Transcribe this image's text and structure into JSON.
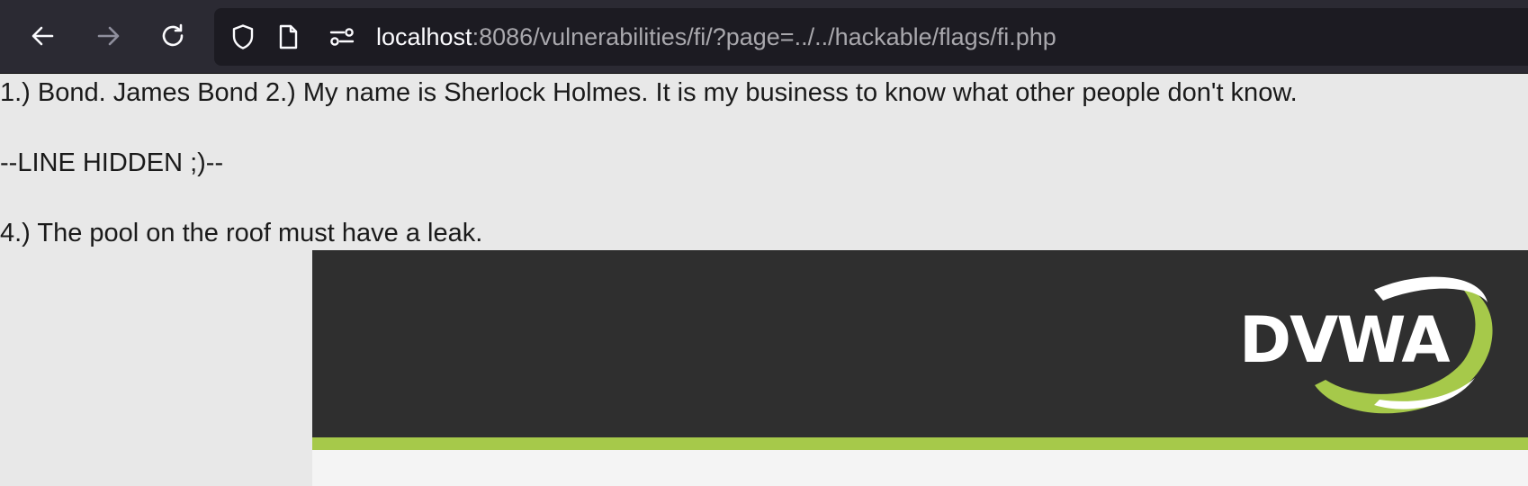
{
  "browser": {
    "url_host": "localhost",
    "url_path": ":8086/vulnerabilities/fi/?page=../../hackable/flags/fi.php"
  },
  "page": {
    "line_1": "1.) Bond. James Bond 2.) My name is Sherlock Holmes. It is my business to know what other people don't know.",
    "line_hidden": "--LINE HIDDEN ;)--",
    "line_4": "4.) The pool on the roof must have a leak."
  },
  "header": {
    "logo_text": "DVWA"
  },
  "colors": {
    "toolbar_bg": "#2b2a33",
    "urlbar_bg": "#1c1b22",
    "page_bg": "#e8e8e8",
    "header_bg": "#2f2f2f",
    "accent_green": "#a6c94a"
  },
  "icons": {
    "back": "arrow-left-icon",
    "forward": "arrow-right-icon",
    "reload": "reload-icon",
    "shield": "shield-icon",
    "page": "page-icon",
    "permissions": "permissions-icon"
  }
}
